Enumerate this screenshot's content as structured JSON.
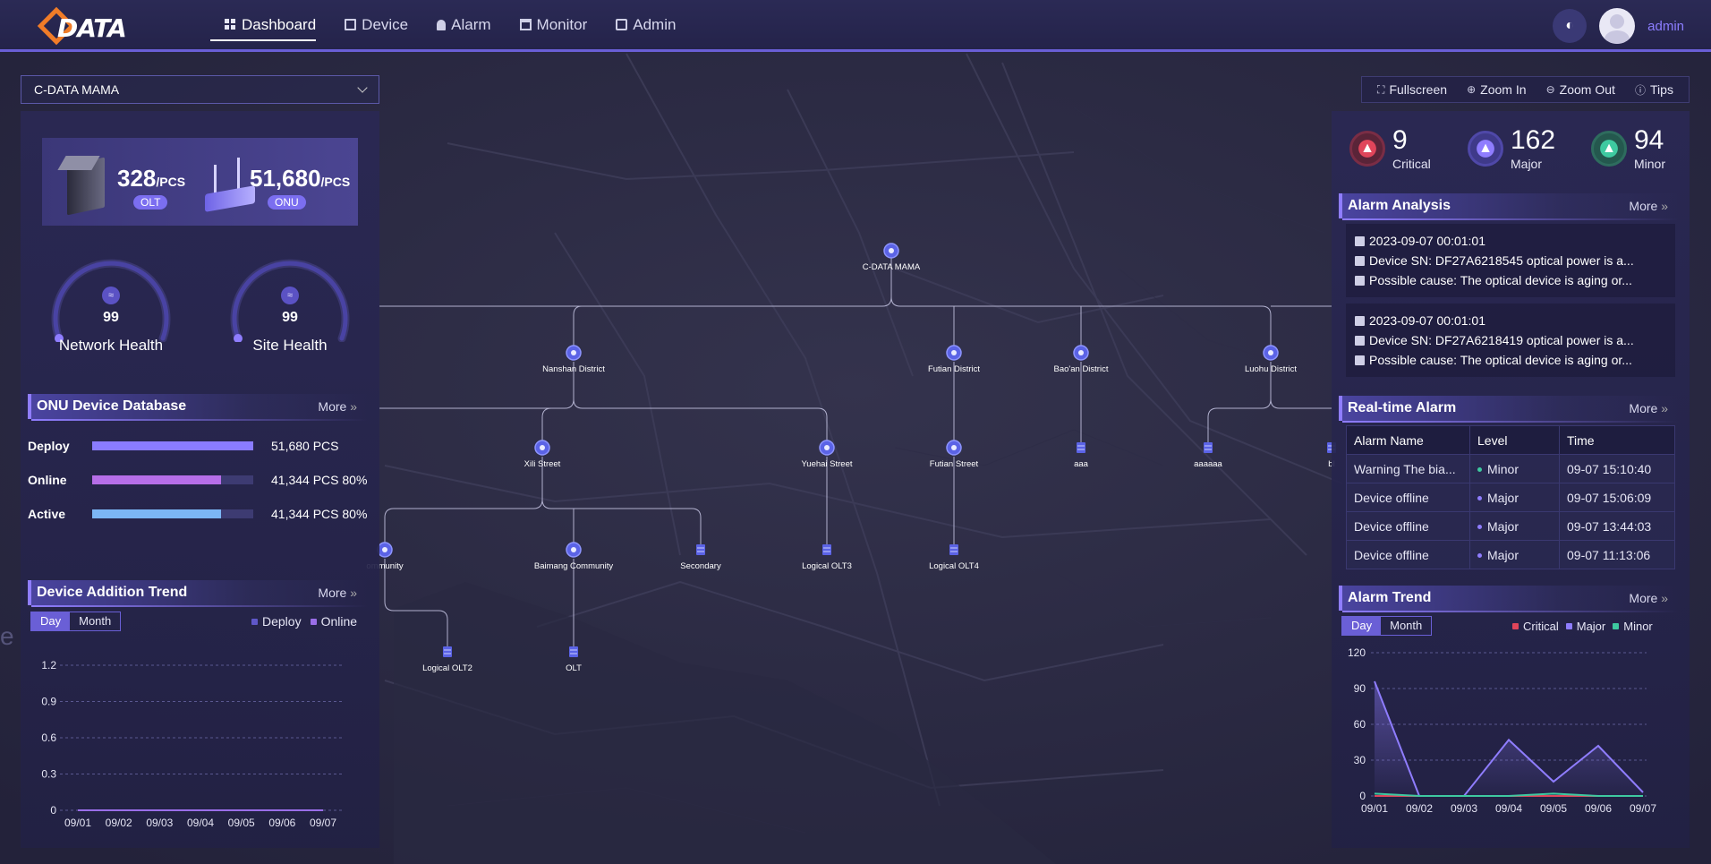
{
  "app": {
    "logo_text": "DATA"
  },
  "nav": {
    "items": [
      {
        "label": "Dashboard",
        "icon": "grid-icon",
        "active": true
      },
      {
        "label": "Device",
        "icon": "device-icon",
        "active": false
      },
      {
        "label": "Alarm",
        "icon": "bell-icon",
        "active": false
      },
      {
        "label": "Monitor",
        "icon": "monitor-icon",
        "active": false
      },
      {
        "label": "Admin",
        "icon": "admin-icon",
        "active": false
      }
    ],
    "username": "admin"
  },
  "site_select": {
    "value": "C-DATA MAMA"
  },
  "map_tools": {
    "fullscreen": "Fullscreen",
    "zoom_in": "Zoom In",
    "zoom_out": "Zoom Out",
    "tips": "Tips"
  },
  "summary": {
    "olt_count": "328",
    "olt_unit": "/PCS",
    "olt_badge": "OLT",
    "onu_count": "51,680",
    "onu_unit": "/PCS",
    "onu_badge": "ONU"
  },
  "health": {
    "network": {
      "value": "99",
      "label": "Network Health"
    },
    "site": {
      "value": "99",
      "label": "Site Health"
    }
  },
  "onu_db": {
    "title": "ONU Device Database",
    "more": "More",
    "rows": [
      {
        "label": "Deploy",
        "text": "51,680 PCS",
        "fill": 1.0,
        "color": "#8a7cff"
      },
      {
        "label": "Online",
        "text": "41,344 PCS 80%",
        "fill": 0.8,
        "color": "#b66ee8"
      },
      {
        "label": "Active",
        "text": "41,344 PCS 80%",
        "fill": 0.8,
        "color": "#7cb6f5"
      }
    ]
  },
  "device_trend": {
    "title": "Device Addition Trend",
    "more": "More",
    "tabs": [
      "Day",
      "Month"
    ],
    "legend": [
      "Deploy",
      "Online"
    ],
    "side_glyph": "e"
  },
  "severity": {
    "critical": {
      "count": "9",
      "label": "Critical",
      "color": "#e0455a"
    },
    "major": {
      "count": "162",
      "label": "Major",
      "color": "#8f7dff"
    },
    "minor": {
      "count": "94",
      "label": "Minor",
      "color": "#3ec9a0"
    }
  },
  "alarm_analysis": {
    "title": "Alarm Analysis",
    "more": "More",
    "cards": [
      {
        "time": "2023-09-07 00:01:01",
        "device": "Device SN: DF27A6218545 optical power is a...",
        "cause": "Possible cause: The optical device is aging or..."
      },
      {
        "time": "2023-09-07 00:01:01",
        "device": "Device SN: DF27A6218419 optical power is a...",
        "cause": "Possible cause: The optical device is aging or..."
      }
    ]
  },
  "realtime_alarm": {
    "title": "Real-time Alarm",
    "more": "More",
    "columns": [
      "Alarm Name",
      "Level",
      "Time"
    ],
    "rows": [
      {
        "name": "Warning The bia...",
        "level": "Minor",
        "time": "09-07 15:10:40"
      },
      {
        "name": "Device offline",
        "level": "Major",
        "time": "09-07 15:06:09"
      },
      {
        "name": "Device offline",
        "level": "Major",
        "time": "09-07 13:44:03"
      },
      {
        "name": "Device offline",
        "level": "Major",
        "time": "09-07 11:13:06"
      }
    ]
  },
  "alarm_trend": {
    "title": "Alarm Trend",
    "more": "More",
    "tabs": [
      "Day",
      "Month"
    ],
    "legend": [
      "Critical",
      "Major",
      "Minor"
    ]
  },
  "topology": {
    "nodes": [
      {
        "id": "root",
        "label": "C-DATA MAMA",
        "type": "site"
      },
      {
        "id": "nanshan",
        "label": "Nanshan District",
        "type": "district"
      },
      {
        "id": "futian",
        "label": "Futian District",
        "type": "district"
      },
      {
        "id": "baoan",
        "label": "Bao'an District",
        "type": "district"
      },
      {
        "id": "luohu",
        "label": "Luohu District",
        "type": "district"
      },
      {
        "id": "xili",
        "label": "Xili Street",
        "type": "street"
      },
      {
        "id": "yuehai",
        "label": "Yuehai Street",
        "type": "street"
      },
      {
        "id": "futianst",
        "label": "Futian Street",
        "type": "street"
      },
      {
        "id": "aaa",
        "label": "aaa",
        "type": "olt"
      },
      {
        "id": "aaaaaa",
        "label": "aaaaaa",
        "type": "olt"
      },
      {
        "id": "bl",
        "label": "bl",
        "type": "olt"
      },
      {
        "id": "community",
        "label": "ommunity",
        "type": "community"
      },
      {
        "id": "baimang",
        "label": "Baimang Community",
        "type": "community"
      },
      {
        "id": "secondary",
        "label": "Secondary",
        "type": "olt"
      },
      {
        "id": "lolt3",
        "label": "Logical OLT3",
        "type": "olt"
      },
      {
        "id": "lolt4",
        "label": "Logical OLT4",
        "type": "olt"
      },
      {
        "id": "lolt2",
        "label": "Logical OLT2",
        "type": "olt"
      },
      {
        "id": "olt",
        "label": "OLT",
        "type": "olt"
      }
    ]
  },
  "chart_data": [
    {
      "type": "line",
      "title": "Device Addition Trend",
      "categories": [
        "09/01",
        "09/02",
        "09/03",
        "09/04",
        "09/05",
        "09/06",
        "09/07"
      ],
      "series": [
        {
          "name": "Deploy",
          "values": [
            0,
            0,
            0,
            0,
            0,
            0,
            0
          ]
        },
        {
          "name": "Online",
          "values": [
            0,
            0,
            0,
            0,
            0,
            0,
            0
          ]
        }
      ],
      "yticks": [
        "0",
        "0.3",
        "0.6",
        "0.9",
        "1.2"
      ],
      "ylim": [
        0,
        1.2
      ],
      "grid": true,
      "legend": "top-right"
    },
    {
      "type": "area",
      "title": "Alarm Trend",
      "categories": [
        "09/01",
        "09/02",
        "09/03",
        "09/04",
        "09/05",
        "09/06",
        "09/07"
      ],
      "series": [
        {
          "name": "Critical",
          "values": [
            0,
            0,
            0,
            0,
            0,
            0,
            0
          ]
        },
        {
          "name": "Major",
          "values": [
            96,
            0,
            0,
            47,
            12,
            42,
            3
          ]
        },
        {
          "name": "Minor",
          "values": [
            2,
            0,
            0,
            0,
            2,
            0,
            0
          ]
        }
      ],
      "yticks": [
        "0",
        "30",
        "60",
        "90",
        "120"
      ],
      "ylim": [
        0,
        120
      ],
      "grid": true,
      "legend": "top-right"
    }
  ],
  "colors": {
    "accent": "#6a5fd6",
    "deploy": "#5f57c9",
    "online": "#9a6ee8"
  }
}
